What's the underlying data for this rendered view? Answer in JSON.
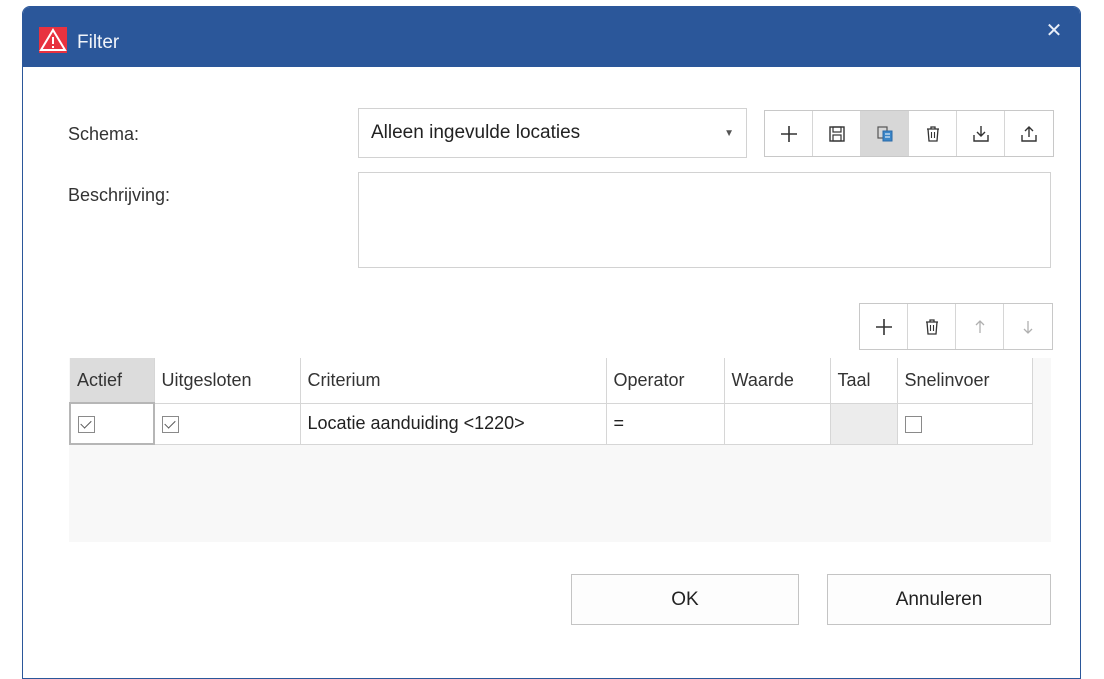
{
  "window": {
    "title": "Filter",
    "close_symbol": "✕"
  },
  "form": {
    "schema_label": "Schema:",
    "schema_value": "Alleen ingevulde locaties",
    "description_label": "Beschrijving:",
    "description_value": ""
  },
  "schema_toolbar": [
    "add-icon",
    "save-icon",
    "copy-icon",
    "delete-icon",
    "import-icon",
    "export-icon"
  ],
  "grid_toolbar": [
    "add-icon",
    "delete-icon",
    "move-up-icon",
    "move-down-icon"
  ],
  "grid": {
    "columns": [
      "Actief",
      "Uitgesloten",
      "Criterium",
      "Operator",
      "Waarde",
      "Taal",
      "Snelinvoer"
    ],
    "rows": [
      {
        "actief": true,
        "uitgesloten": true,
        "criterium": "Locatie aanduiding <1220>",
        "operator": "=",
        "waarde": "",
        "taal": "",
        "snelinvoer": false
      }
    ]
  },
  "buttons": {
    "ok": "OK",
    "cancel": "Annuleren"
  },
  "colors": {
    "titlebar": "#2b579a",
    "app_icon": "#e8323f"
  }
}
